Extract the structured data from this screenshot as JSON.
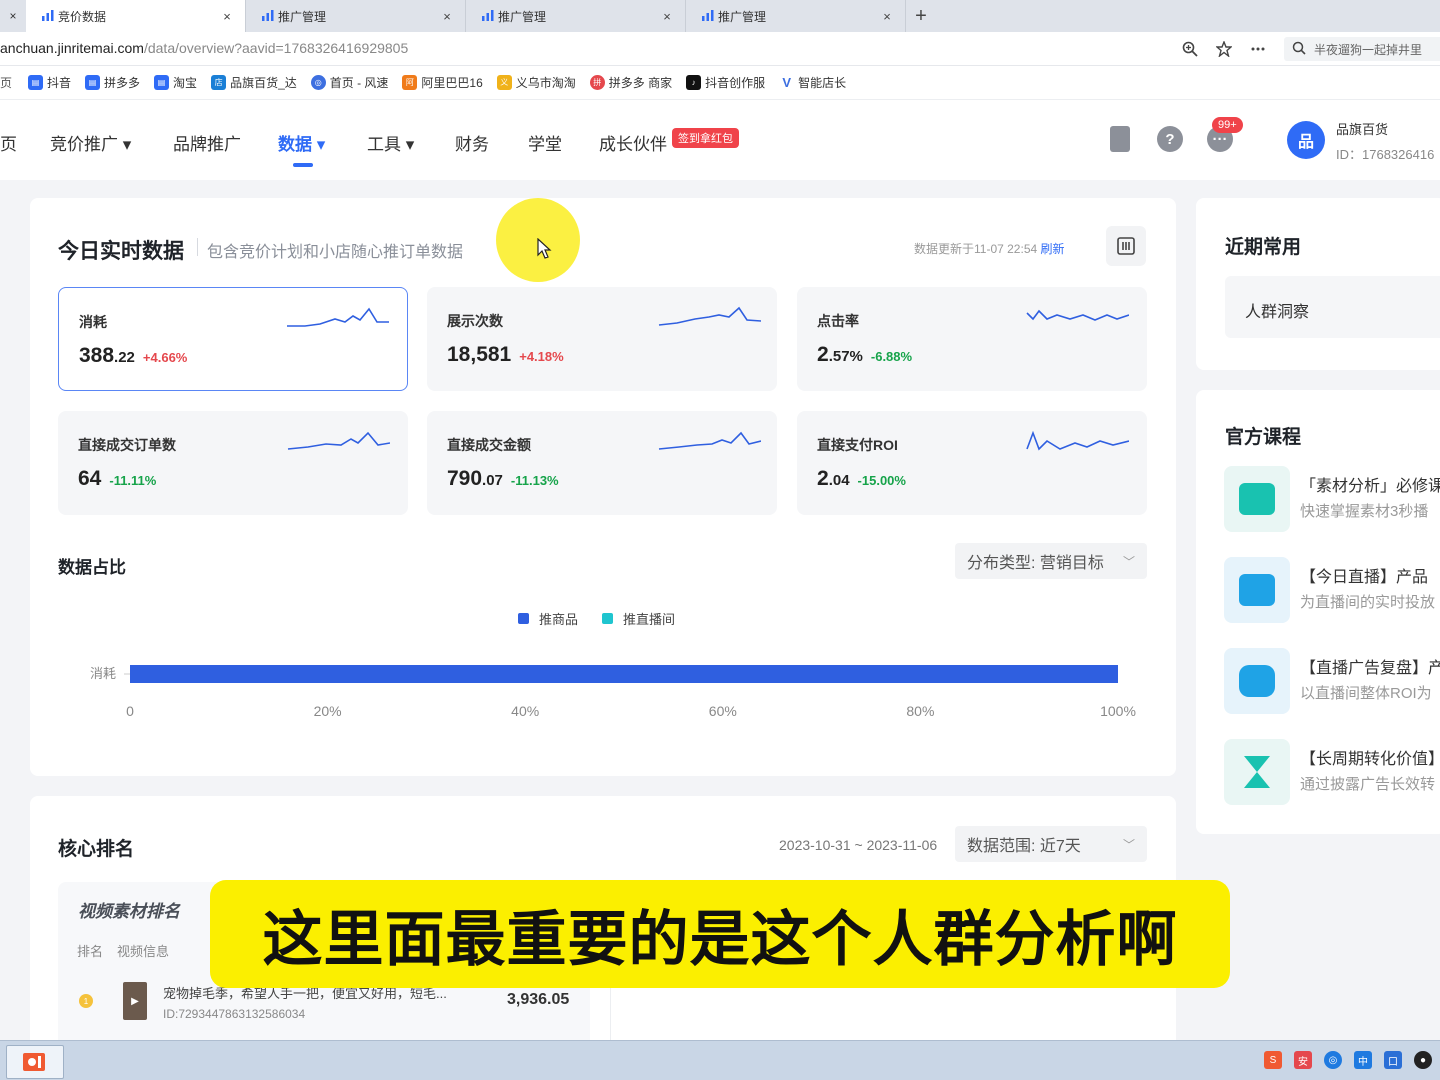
{
  "browser": {
    "tabs": [
      {
        "label": "竞价数据",
        "active": true
      },
      {
        "label": "推广管理",
        "active": false
      },
      {
        "label": "推广管理",
        "active": false
      },
      {
        "label": "推广管理",
        "active": false
      }
    ],
    "new_tab": "+",
    "close_glyph": "×",
    "url_host": "anchuan.jinritemai.com",
    "url_path": "/data/overview?aavid=1768326416929805",
    "search_text": "半夜遛狗一起掉井里",
    "bookmarks": [
      {
        "label": "抖音",
        "color": "#2f6bf6"
      },
      {
        "label": "拼多多",
        "color": "#2f6bf6"
      },
      {
        "label": "淘宝",
        "color": "#2f6bf6"
      },
      {
        "label": "品旗百货_达",
        "color": "#1a7fd6"
      },
      {
        "label": "首页 - 风速",
        "color": "#3d6fe0"
      },
      {
        "label": "阿里巴巴16",
        "color": "#f07b1a"
      },
      {
        "label": "义乌市淘淘",
        "color": "#f0b21a"
      },
      {
        "label": "拼多多 商家",
        "color": "#e5484d"
      },
      {
        "label": "抖音创作服",
        "color": "#111111"
      },
      {
        "label": "智能店长",
        "color": "#3d6fe0"
      }
    ]
  },
  "nav": {
    "items": [
      "页",
      "竞价推广 ▾",
      "品牌推广",
      "数据 ▾",
      "工具 ▾",
      "财务",
      "学堂",
      "成长伙伴"
    ],
    "promo_badge": "签到拿红包",
    "notify_badge": "99+",
    "account_name": "品旗百货",
    "account_id": "ID：1768326416",
    "avatar_text": "品"
  },
  "realtime": {
    "title": "今日实时数据",
    "subtitle": "包含竞价计划和小店随心推订单数据",
    "update_text": "数据更新于11-07 22:54",
    "refresh": "刷新",
    "metrics": [
      {
        "label": "消耗",
        "int": "388",
        "dec": ".22",
        "change": "+4.66%",
        "dir": "up"
      },
      {
        "label": "展示次数",
        "int": "18,581",
        "dec": "",
        "change": "+4.18%",
        "dir": "up"
      },
      {
        "label": "点击率",
        "int": "2",
        "dec": ".57%",
        "change": "-6.88%",
        "dir": "down"
      },
      {
        "label": "直接成交订单数",
        "int": "64",
        "dec": "",
        "change": "-11.11%",
        "dir": "down"
      },
      {
        "label": "直接成交金额",
        "int": "790",
        "dec": ".07",
        "change": "-11.13%",
        "dir": "down"
      },
      {
        "label": "直接支付ROI",
        "int": "2",
        "dec": ".04",
        "change": "-15.00%",
        "dir": "down"
      }
    ]
  },
  "share": {
    "title": "数据占比",
    "dropdown": "分布类型: 营销目标",
    "legend": [
      {
        "name": "推商品",
        "color": "#2f5fe0"
      },
      {
        "name": "推直播间",
        "color": "#1fc5cf"
      }
    ]
  },
  "chart_data": {
    "type": "bar",
    "orientation": "horizontal",
    "categories": [
      "消耗"
    ],
    "series": [
      {
        "name": "推商品",
        "values": [
          100
        ]
      },
      {
        "name": "推直播间",
        "values": [
          0
        ]
      }
    ],
    "xlim": [
      0,
      100
    ],
    "x_ticks": [
      "0",
      "20%",
      "40%",
      "60%",
      "80%",
      "100%"
    ],
    "legend_placement": "top-center",
    "grid": false
  },
  "ranking": {
    "title": "核心排名",
    "date_range": "2023-10-31 ~ 2023-11-06",
    "dropdown": "数据范围: 近7天",
    "sub_title": "视频素材排名",
    "col_rank": "排名",
    "col_video": "视频信息",
    "rows": [
      {
        "title": "宠物掉毛季，希望人手一把，便宜又好用，短毛...",
        "id": "ID:7293447863132586034",
        "value": "3,936.05"
      }
    ]
  },
  "sidebar": {
    "recent_title": "近期常用",
    "recent_item": "人群洞察",
    "courses_title": "官方课程",
    "courses": [
      {
        "title": "「素材分析」必修课",
        "desc": "快速掌握素材3秒播",
        "color": "#19c2b0"
      },
      {
        "title": "【今日直播】产品",
        "desc": "为直播间的实时投放",
        "color": "#1fa3e6"
      },
      {
        "title": "【直播广告复盘】产",
        "desc": "以直播间整体ROI为",
        "color": "#1fa3e6"
      },
      {
        "title": "【长周期转化价值】",
        "desc": "通过披露广告长效转",
        "color": "#19c2b0"
      }
    ]
  },
  "caption": "这里面最重要的是这个人群分析啊"
}
